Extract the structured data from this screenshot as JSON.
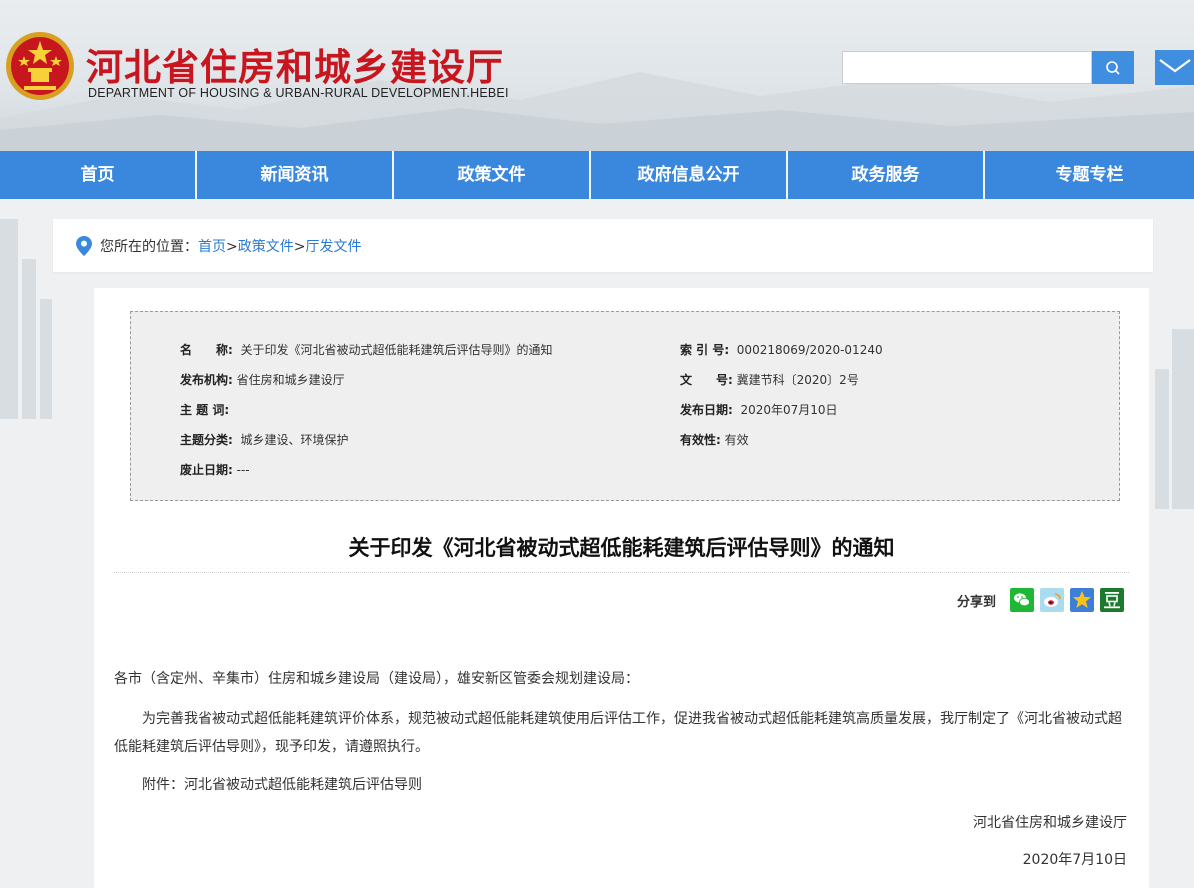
{
  "header": {
    "site_title": "河北省住房和城乡建设厅",
    "site_subtitle": "DEPARTMENT OF HOUSING & URBAN-RURAL DEVELOPMENT.HEBEI",
    "search_placeholder": "",
    "search_icon": "search-icon",
    "mail_icon": "mail-icon"
  },
  "nav": {
    "items": [
      "首页",
      "新闻资讯",
      "政策文件",
      "政府信息公开",
      "政务服务",
      "专题专栏"
    ]
  },
  "breadcrumb": {
    "prefix": "您所在的位置：",
    "items": [
      "首页",
      "政策文件",
      "厅发文件"
    ],
    "separator": ">"
  },
  "meta": {
    "name_label": "名　　称:",
    "name_value": "关于印发《河北省被动式超低能耗建筑后评估导则》的通知",
    "index_label": "索 引 号:",
    "index_value": "000218069/2020-01240",
    "org_label": "发布机构:",
    "org_value": "省住房和城乡建设厅",
    "docno_label": "文　　号:",
    "docno_value": "冀建节科〔2020〕2号",
    "keyword_label": "主 题 词:",
    "keyword_value": "",
    "date_label": "发布日期:",
    "date_value": "2020年07月10日",
    "category_label": "主题分类:",
    "category_value": "城乡建设、环境保护",
    "validity_label": "有效性:",
    "validity_value": "有效",
    "expire_label": "废止日期:",
    "expire_value": "---"
  },
  "article": {
    "title": "关于印发《河北省被动式超低能耗建筑后评估导则》的通知",
    "share_label": "分享到",
    "share_icons": [
      "wechat-icon",
      "weibo-icon",
      "qzone-icon",
      "douban-icon"
    ],
    "salutation": "各市（含定州、辛集市）住房和城乡建设局（建设局），雄安新区管委会规划建设局：",
    "body_line1": "为完善我省被动式超低能耗建筑评价体系，规范被动式超低能耗建筑使用后评估工作，促进我省被动式超低能耗建筑高质量发展，我厅制定了《河北省被动式超",
    "body_line2": "低能耗建筑后评估导则》，现予印发，请遵照执行。",
    "attachment": "附件：河北省被动式超低能耗建筑后评估导则",
    "signature": "河北省住房和城乡建设厅",
    "date": "2020年7月10日"
  },
  "colors": {
    "nav_blue": "#3a88dd",
    "title_red": "#c8161e",
    "link_blue": "#2a7ad1"
  }
}
